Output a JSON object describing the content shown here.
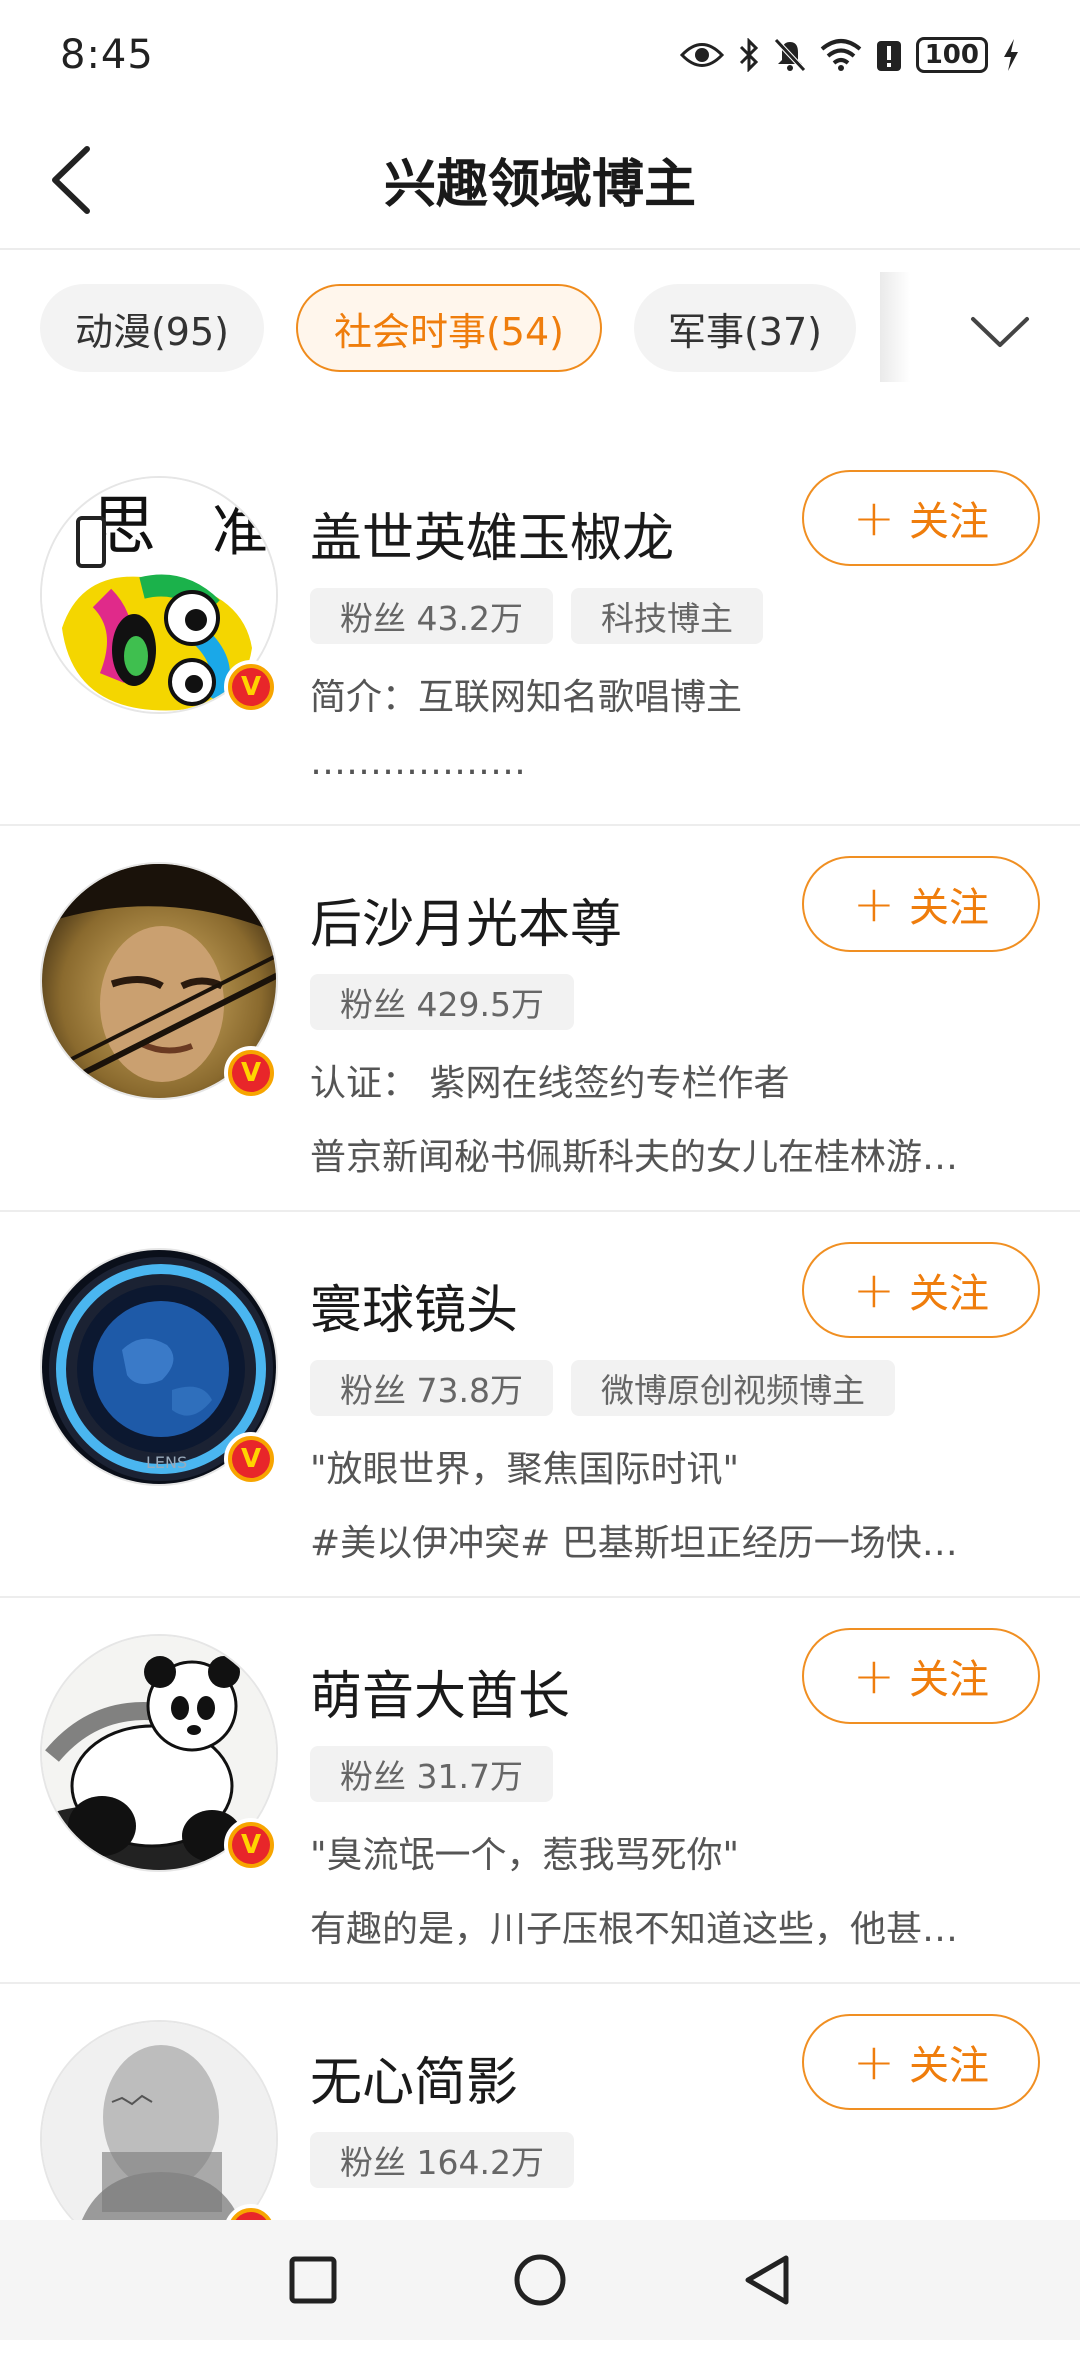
{
  "status": {
    "time": "8:45",
    "battery": "100",
    "icons": [
      "eye-icon",
      "bluetooth-icon",
      "mute-icon",
      "wifi-icon",
      "alert-icon",
      "battery-icon",
      "charging-icon"
    ]
  },
  "header": {
    "title": "兴趣领域博主",
    "back_icon": "chevron-left-icon"
  },
  "tabs": [
    {
      "label": "动漫(95)",
      "active": false
    },
    {
      "label": "社会时事(54)",
      "active": true
    },
    {
      "label": "军事(37)",
      "active": false
    }
  ],
  "follow_label": "关注",
  "bloggers": [
    {
      "name": "盖世英雄玉椒龙",
      "tags": [
        "粉丝 43.2万",
        "科技博主"
      ],
      "line1": "简介：互联网知名歌唱博主",
      "line2": "………………"
    },
    {
      "name": "后沙月光本尊",
      "tags": [
        "粉丝 429.5万"
      ],
      "line1": "认证：  紫网在线签约专栏作者",
      "line2": "普京新闻秘书佩斯科夫的女儿在桂林游…"
    },
    {
      "name": "寰球镜头",
      "tags": [
        "粉丝 73.8万",
        "微博原创视频博主"
      ],
      "line1": "\"放眼世界，聚焦国际时讯\"",
      "line2": "#美以伊冲突# 巴基斯坦正经历一场快…"
    },
    {
      "name": "萌音大酋长",
      "tags": [
        "粉丝 31.7万"
      ],
      "line1": "\"臭流氓一个，惹我骂死你\"",
      "line2": "有趣的是，川子压根不知道这些，他甚…"
    },
    {
      "name": "无心简影",
      "tags": [
        "粉丝 164.2万"
      ],
      "line1": "",
      "line2": ""
    }
  ],
  "nav": {
    "icons": [
      "recent-apps-icon",
      "home-icon",
      "back-icon"
    ]
  },
  "colors": {
    "accent": "#ef7d0c",
    "verified_outer": "#f7a500",
    "verified_inner": "#e8262a"
  }
}
